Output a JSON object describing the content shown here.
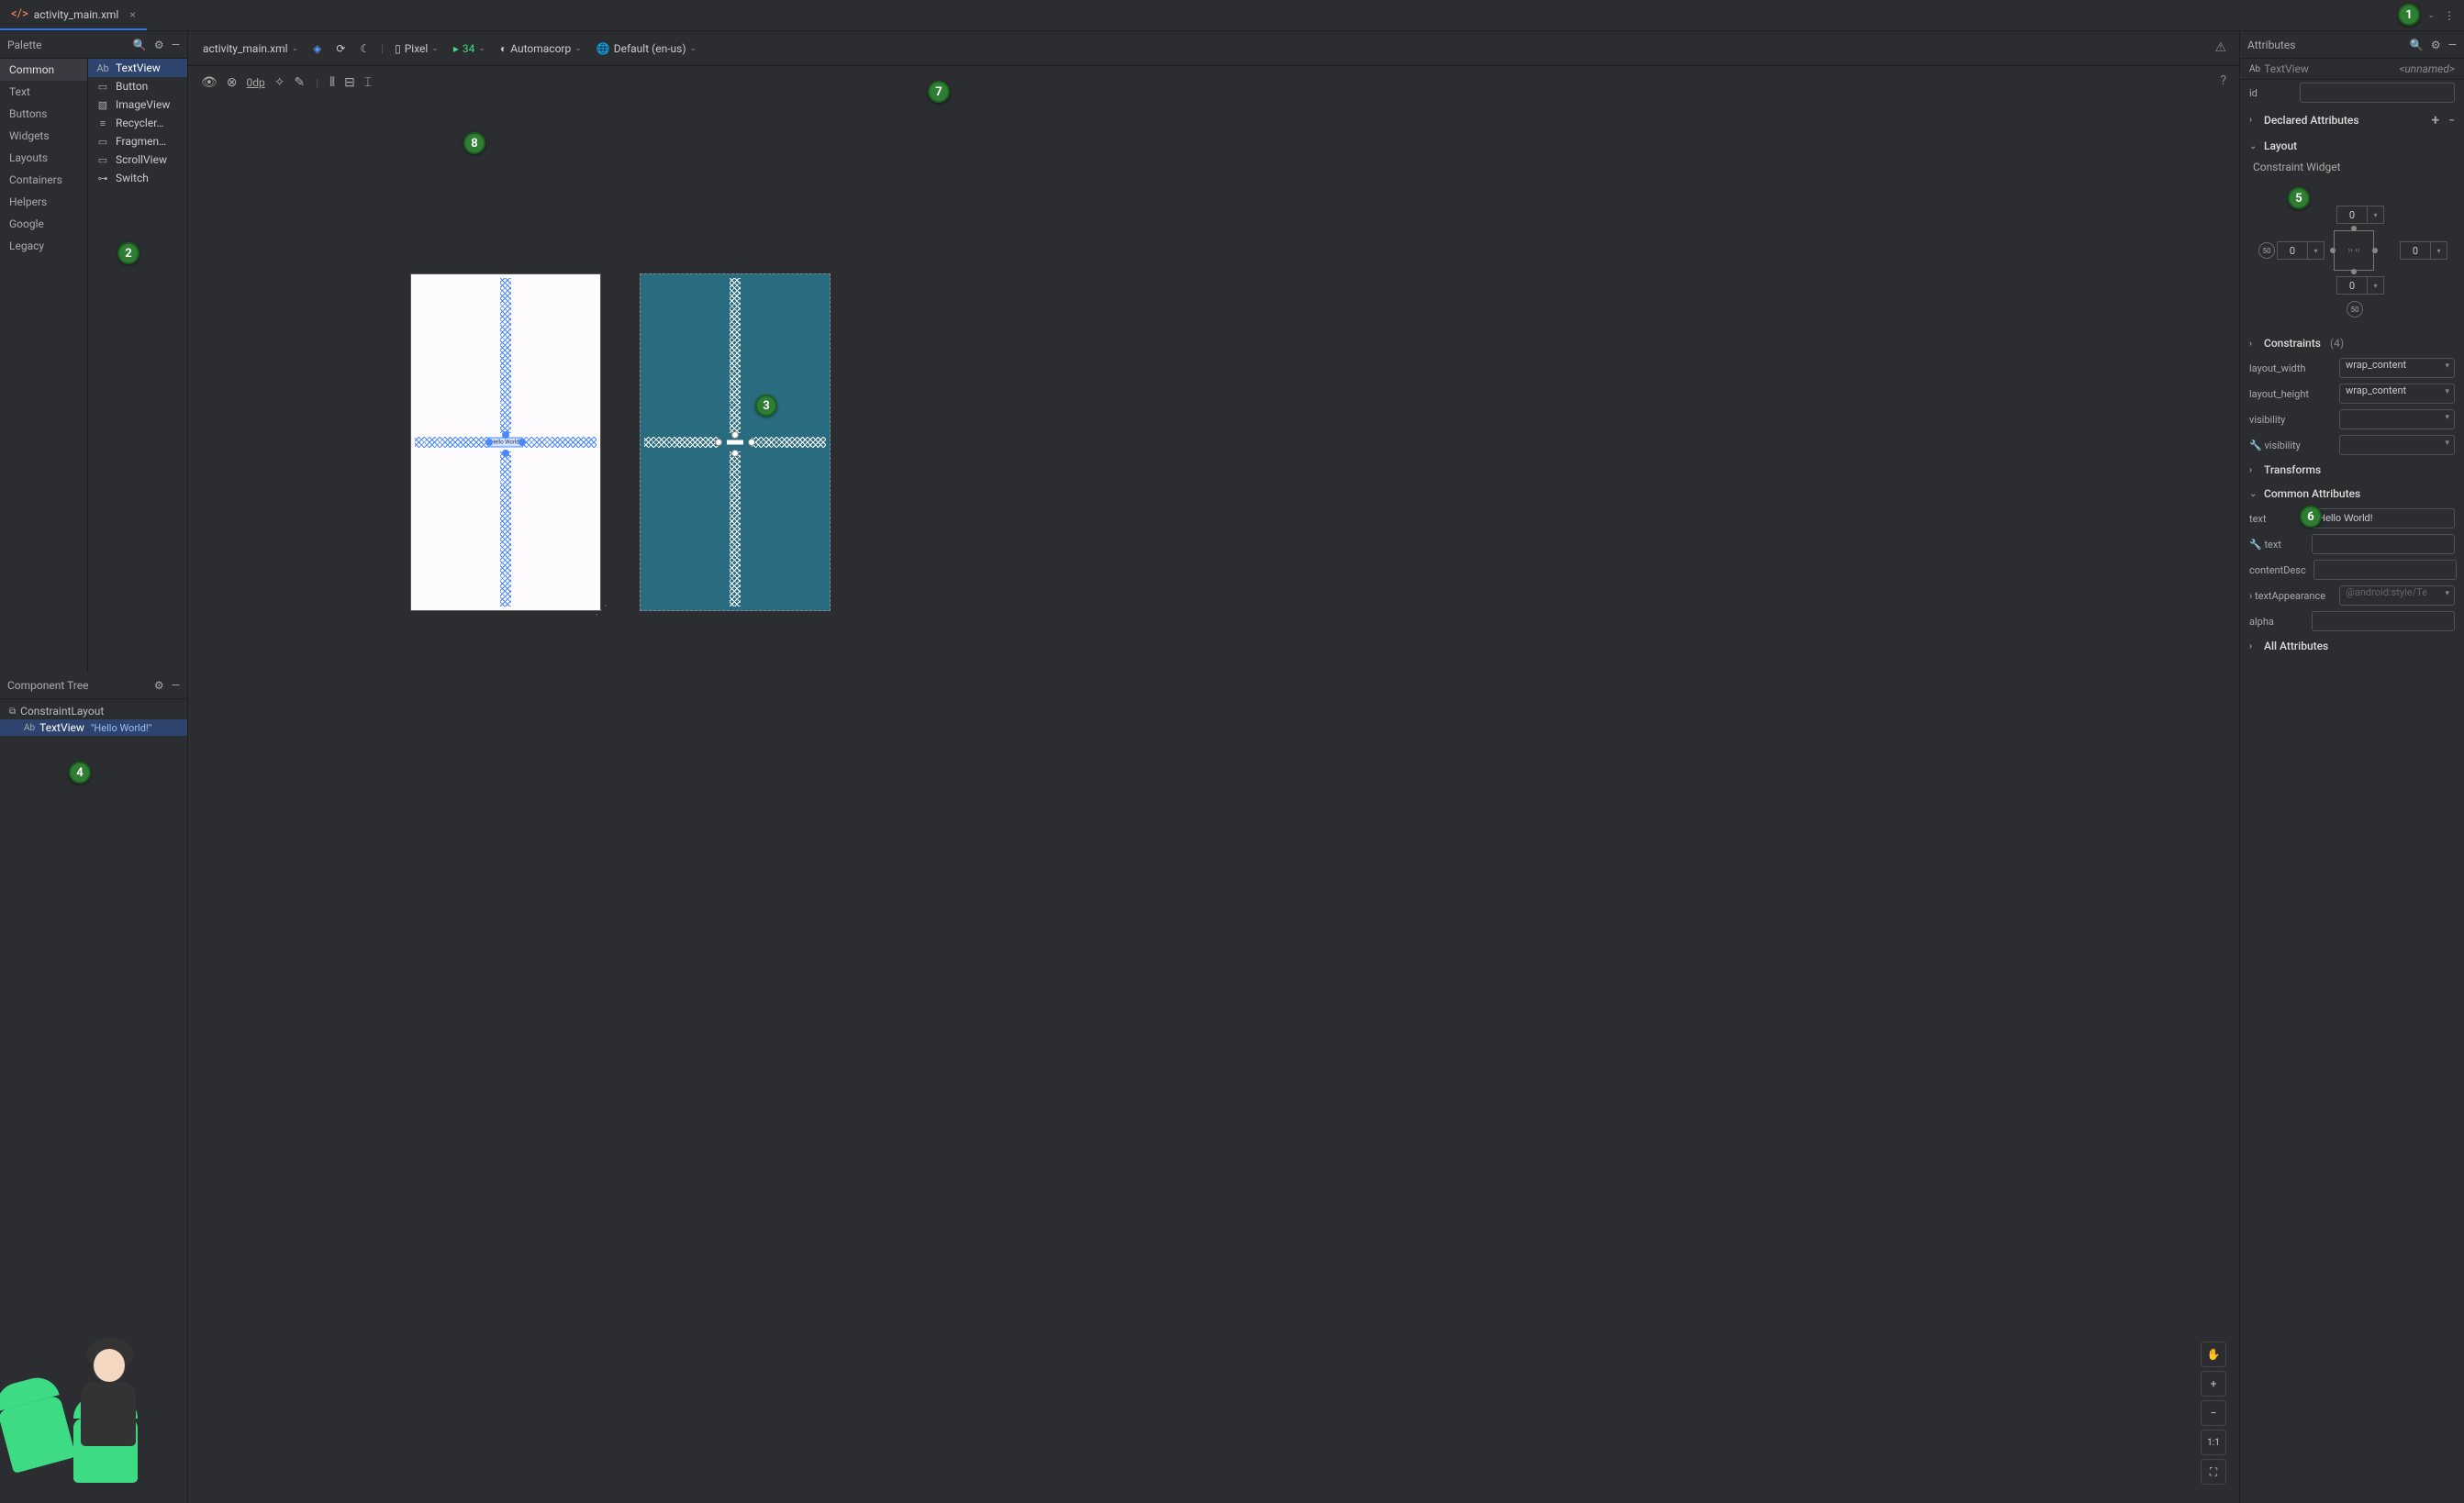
{
  "tab": {
    "filename": "activity_main.xml"
  },
  "palette": {
    "title": "Palette",
    "categories": [
      "Common",
      "Text",
      "Buttons",
      "Widgets",
      "Layouts",
      "Containers",
      "Helpers",
      "Google",
      "Legacy"
    ],
    "selectedCategory": "Common",
    "items": [
      {
        "icon": "Ab",
        "label": "TextView",
        "selected": true
      },
      {
        "icon": "▭",
        "label": "Button"
      },
      {
        "icon": "▧",
        "label": "ImageView"
      },
      {
        "icon": "≡",
        "label": "Recycler…"
      },
      {
        "icon": "▭",
        "label": "Fragmen…"
      },
      {
        "icon": "▭",
        "label": "ScrollView"
      },
      {
        "icon": "⊶",
        "label": "Switch"
      }
    ]
  },
  "componentTree": {
    "title": "Component Tree",
    "rows": [
      {
        "icon": "⧉",
        "label": "ConstraintLayout",
        "indent": false,
        "selected": false
      },
      {
        "icon": "Ab",
        "label": "TextView",
        "sub": "\"Hello World!\"",
        "indent": true,
        "selected": true
      }
    ]
  },
  "designToolbar": {
    "file": "activity_main.xml",
    "device": "Pixel",
    "api": "34",
    "theme": "Automacorp",
    "locale": "Default (en-us)",
    "margin": "0dp"
  },
  "canvas": {
    "hello": "Hello World!"
  },
  "attributes": {
    "title": "Attributes",
    "type": "TextView",
    "typeIcon": "Ab",
    "unnamed": "<unnamed>",
    "id_label": "id",
    "id_value": "",
    "declared": "Declared Attributes",
    "layout": "Layout",
    "constraint_widget": "Constraint Widget",
    "cw": {
      "top": "0",
      "bottom": "0",
      "left": "0",
      "right": "0",
      "badge": "50"
    },
    "constraints": "Constraints",
    "constraints_count": "(4)",
    "layout_width_label": "layout_width",
    "layout_width": "wrap_content",
    "layout_height_label": "layout_height",
    "layout_height": "wrap_content",
    "visibility_label": "visibility",
    "visibility": "",
    "tools_visibility_label": "visibility",
    "tools_visibility": "",
    "transforms": "Transforms",
    "common": "Common Attributes",
    "text_label": "text",
    "text": "Hello World!",
    "tools_text_label": "text",
    "tools_text": "",
    "contentDesc_label": "contentDesc",
    "contentDesc": "",
    "textAppearance_label": "textAppearance",
    "textAppearance": "@android:style/Te",
    "alpha_label": "alpha",
    "alpha": "",
    "all": "All Attributes"
  },
  "badges": {
    "1": "1",
    "2": "2",
    "3": "3",
    "4": "4",
    "5": "5",
    "6": "6",
    "7": "7",
    "8": "8"
  }
}
